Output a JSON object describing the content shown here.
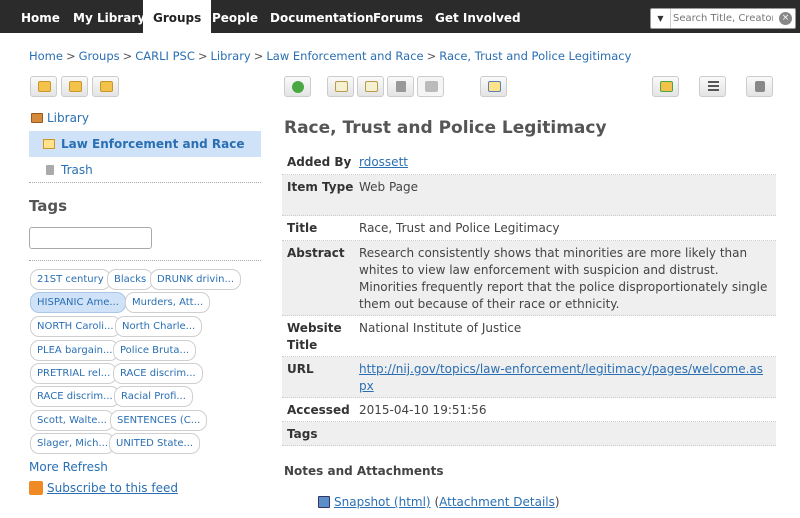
{
  "nav": {
    "home": "Home",
    "my_library": "My Library",
    "groups": "Groups",
    "people": "People",
    "documentation": "Documentation",
    "forums": "Forums",
    "get_involved": "Get Involved",
    "search_placeholder": "Search Title, Creator, Ye"
  },
  "breadcrumb": [
    "Home",
    "Groups",
    "CARLI PSC",
    "Library",
    "Law Enforcement and Race",
    "Race, Trust and Police Legitimacy"
  ],
  "tree": {
    "library": "Library",
    "collection": "Law Enforcement and Race",
    "trash": "Trash"
  },
  "tags": {
    "title": "Tags",
    "items": [
      "21ST century",
      "Blacks",
      "DRUNK drivin...",
      "HISPANIC Ame...",
      "Murders, Att...",
      "NORTH Caroli...",
      "North Charle...",
      "PLEA bargain...",
      "Police Bruta...",
      "PRETRIAL rel...",
      "RACE discrim...",
      "RACE discrim...",
      "Racial Profi...",
      "Scott, Walte...",
      "SENTENCES (C...",
      "Slager, Mich...",
      "UNITED State..."
    ],
    "more": "More",
    "refresh": "Refresh",
    "subscribe": "Subscribe to this feed"
  },
  "item": {
    "title": "Race, Trust and Police Legitimacy",
    "fields": {
      "added_by_label": "Added By",
      "added_by": "rdossett",
      "type_label": "Item Type",
      "type": "Web Page",
      "title_label": "Title",
      "title": "Race, Trust and Police Legitimacy",
      "abstract_label": "Abstract",
      "abstract": "Research consistently shows that minorities are more likely than whites to view law enforcement with suspicion and distrust. Minorities frequently report that the police disproportionately single them out because of their race or ethnicity.",
      "website_label": "Website Title",
      "website": "National Institute of Justice",
      "url_label": "URL",
      "url": "http://nij.gov/topics/law-enforcement/legitimacy/pages/welcome.aspx",
      "accessed_label": "Accessed",
      "accessed": "2015-04-10 19:51:56",
      "tags_label": "Tags"
    }
  },
  "notes": {
    "title": "Notes and Attachments",
    "snapshot": "Snapshot (html)",
    "attach_open": "(",
    "attach_details": "Attachment Details",
    "attach_close": ")"
  }
}
